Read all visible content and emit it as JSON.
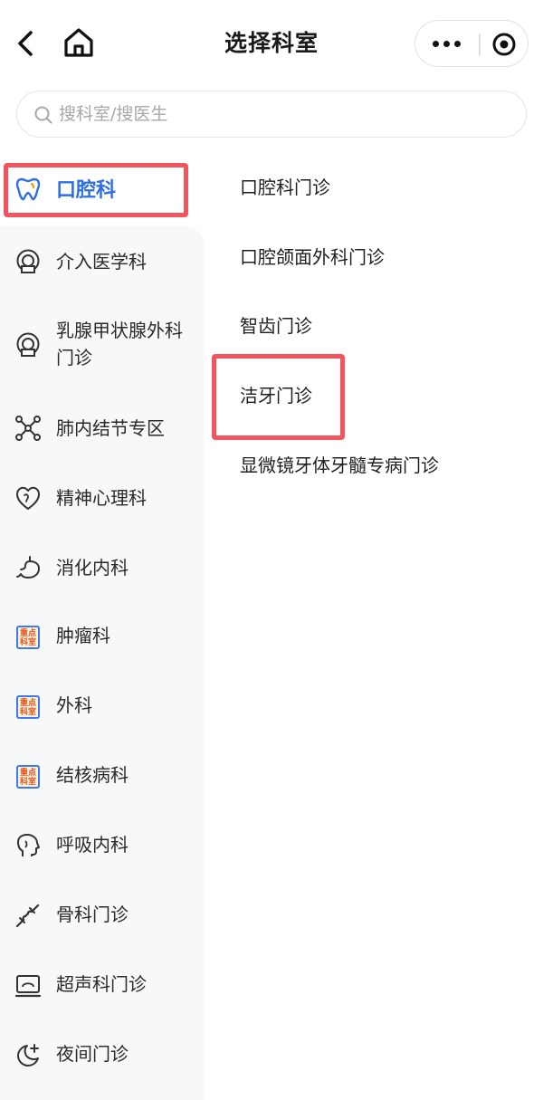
{
  "header": {
    "title": "选择科室",
    "back_icon": "chevron-left-icon",
    "home_icon": "home-icon",
    "more_icon": "more-dots-icon",
    "target_icon": "record-target-icon"
  },
  "search": {
    "placeholder": "搜科室/搜医生"
  },
  "colors": {
    "accent": "#2f6fe4",
    "highlight": "#f2555f",
    "sidebar_bg": "#f7f8fa",
    "badge_text": "#e8541a"
  },
  "sidebar": {
    "active": {
      "label": "口腔科",
      "icon": "tooth-icon"
    },
    "items": [
      {
        "label": "介入医学科",
        "icon": "scan-machine-icon"
      },
      {
        "label": "乳腺甲状腺外科门诊",
        "icon": "scan-machine-icon"
      },
      {
        "label": "肺内结节专区",
        "icon": "molecule-nodes-icon"
      },
      {
        "label": "精神心理科",
        "icon": "heart-brain-icon"
      },
      {
        "label": "消化内科",
        "icon": "stomach-icon"
      },
      {
        "label": "肿瘤科",
        "icon": "key-department-badge",
        "badge": "重点科室"
      },
      {
        "label": "外科",
        "icon": "key-department-badge",
        "badge": "重点科室"
      },
      {
        "label": "结核病科",
        "icon": "key-department-badge",
        "badge": "重点科室"
      },
      {
        "label": "呼吸内科",
        "icon": "head-profile-icon"
      },
      {
        "label": "骨科门诊",
        "icon": "bone-joint-icon"
      },
      {
        "label": "超声科门诊",
        "icon": "ultrasound-monitor-icon"
      },
      {
        "label": "夜间门诊",
        "icon": "moon-plus-icon"
      }
    ]
  },
  "clinics": [
    "口腔科门诊",
    "口腔颌面外科门诊",
    "智齿门诊",
    "洁牙门诊",
    "显微镜牙体牙髓专病门诊"
  ]
}
